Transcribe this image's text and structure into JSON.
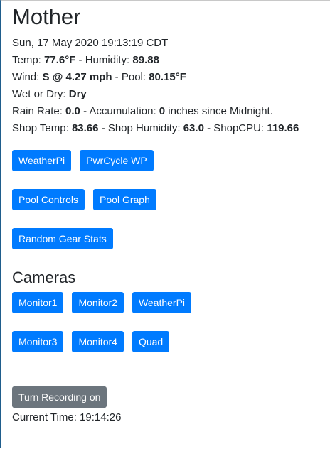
{
  "page": {
    "title": "Mother",
    "datetime": "Sun, 17 May 2020 19:13:19 CDT"
  },
  "weather": {
    "temp_label": "Temp: ",
    "temp_value": "77.6°F",
    "humidity_label": " - Humidity: ",
    "humidity_value": "89.88",
    "wind_label": "Wind: ",
    "wind_value": "S @ 4.27 mph",
    "pool_label": " - Pool: ",
    "pool_value": "80.15°F",
    "wet_label": "Wet or Dry: ",
    "wet_value": "Dry",
    "rain_label": "Rain Rate: ",
    "rain_value": "0.0",
    "accum_label": " - Accumulation: ",
    "accum_value": "0",
    "accum_suffix": " inches since Midnight.",
    "shop_temp_label": "Shop Temp: ",
    "shop_temp_value": "83.66",
    "shop_humidity_label": " - Shop Humidity: ",
    "shop_humidity_value": "63.0",
    "shop_cpu_label": " - ShopCPU: ",
    "shop_cpu_value": "119.66"
  },
  "controls": {
    "weatherpi": "WeatherPi",
    "pwrcycle": "PwrCycle WP",
    "pool_controls": "Pool Controls",
    "pool_graph": "Pool Graph",
    "random_gear": "Random Gear Stats"
  },
  "cameras": {
    "heading": "Cameras",
    "monitor1": "Monitor1",
    "monitor2": "Monitor2",
    "weatherpi": "WeatherPi",
    "monitor3": "Monitor3",
    "monitor4": "Monitor4",
    "quad": "Quad"
  },
  "recording": {
    "button": "Turn Recording on",
    "time_label": "Current Time: ",
    "time_value": "19:14:26"
  },
  "colors": {
    "primary": "#007bff",
    "secondary": "#6c757d",
    "text": "#212529"
  }
}
